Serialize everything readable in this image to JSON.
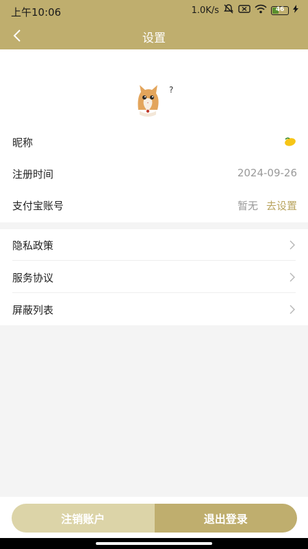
{
  "status_bar": {
    "time": "上午10:06",
    "speed": "1.0K/s",
    "battery": "46",
    "battery_level": 0.46
  },
  "header": {
    "title": "设置",
    "back_icon": "chevron-left-icon",
    "background": "#bfae6e"
  },
  "profile": {
    "avatar_icon": "cat-avatar",
    "avatar_badge": "?",
    "rows": {
      "nickname": {
        "label": "昵称",
        "value_icon": "lemon-emoji"
      },
      "register_time": {
        "label": "注册时间",
        "value": "2024-09-26"
      },
      "alipay": {
        "label": "支付宝账号",
        "value": "暂无",
        "action": "去设置"
      }
    }
  },
  "links": [
    {
      "label": "隐私政策"
    },
    {
      "label": "服务协议"
    },
    {
      "label": "屏蔽列表"
    }
  ],
  "actions": {
    "cancel_account": "注销账户",
    "logout": "退出登录"
  },
  "colors": {
    "accent": "#bfae6e",
    "accent_light": "#dcd4a8",
    "link": "#b9a45f"
  }
}
